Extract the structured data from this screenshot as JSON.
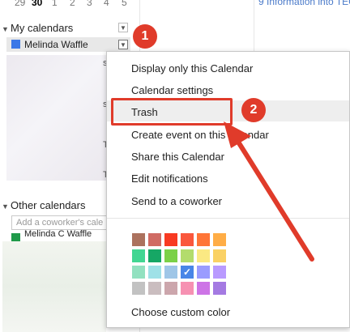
{
  "mini_calendar": {
    "days": [
      "29",
      "30",
      "1",
      "2",
      "3",
      "4",
      "5"
    ],
    "bold_index": 1
  },
  "my_calendars": {
    "heading": "My calendars",
    "items": [
      {
        "name": "Melinda Waffle",
        "color": "#3b78e7"
      }
    ]
  },
  "other_calendars": {
    "heading": "Other calendars",
    "add_coworker_placeholder": "Add a coworker's cale",
    "items": [
      {
        "name": "Melinda C Waffle",
        "color": "#1f9a4a"
      }
    ]
  },
  "top_right_link": "9 Information into TEC",
  "context_menu": {
    "items": [
      "Display only this Calendar",
      "Calendar settings",
      "Trash",
      "Create event on this calendar",
      "Share this Calendar",
      "Edit notifications",
      "Send to a coworker"
    ],
    "custom_color_label": "Choose custom color",
    "palette": [
      [
        "#ac725e",
        "#d06b64",
        "#f83a22",
        "#fa573c",
        "#ff7537",
        "#ffad46"
      ],
      [
        "#42d692",
        "#16a765",
        "#7bd148",
        "#b3dc6c",
        "#fbe983",
        "#fad165"
      ],
      [
        "#92e1c0",
        "#9fe1e7",
        "#9fc6e7",
        "#4986e7",
        "#9a9cff",
        "#b99aff"
      ],
      [
        "#c2c2c2",
        "#cabdbf",
        "#cca6ac",
        "#f691b2",
        "#cd74e6",
        "#a47ae2"
      ]
    ],
    "selected_color": "#4986e7"
  },
  "annotations": {
    "step1": "1",
    "step2": "2"
  },
  "side_marks": {
    "m1": "s",
    "m2": "s",
    "m3": "T",
    "m4": "T"
  }
}
